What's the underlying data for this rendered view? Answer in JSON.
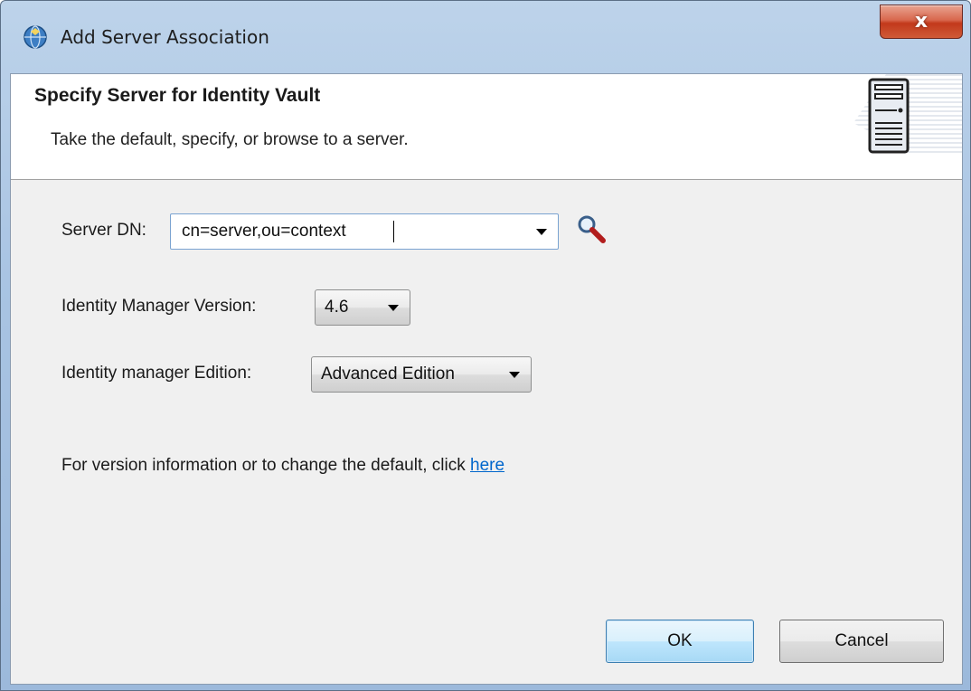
{
  "window": {
    "title": "Add Server Association",
    "close_label": "x"
  },
  "header": {
    "title": "Specify Server for Identity Vault",
    "description": "Take the default, specify, or browse to a server."
  },
  "form": {
    "server_dn_label": "Server DN:",
    "server_dn_value": "cn=server,ou=context",
    "idm_version_label": "Identity Manager Version:",
    "idm_version_value": "4.6",
    "idm_edition_label": "Identity manager Edition:",
    "idm_edition_value": "Advanced Edition",
    "info_text": "For version information or to change the default, click ",
    "info_link": "here"
  },
  "buttons": {
    "ok": "OK",
    "cancel": "Cancel"
  },
  "icons": {
    "app": "globe-icon",
    "banner": "server-icon",
    "browse": "magnifier-icon"
  }
}
